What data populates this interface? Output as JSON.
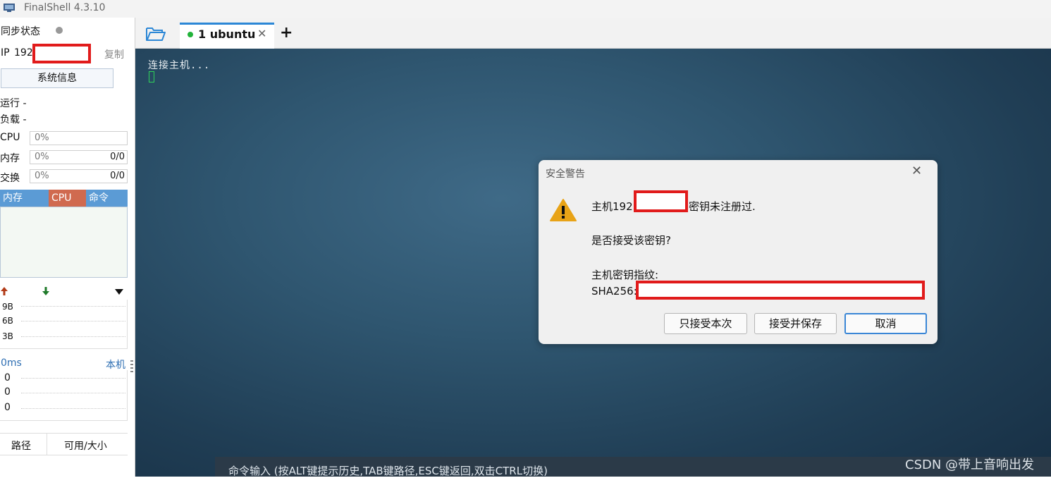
{
  "window": {
    "title": "FinalShell 4.3.10"
  },
  "sidebar": {
    "sync_label": "同步状态",
    "ip_label": "IP",
    "ip_value": "192",
    "copy_label": "复制",
    "sysinfo_button": "系统信息",
    "running_label": "运行 -",
    "load_label": "负载 -",
    "cpu": {
      "label": "CPU",
      "value": "0%"
    },
    "memory": {
      "label": "内存",
      "value": "0%",
      "total": "0/0"
    },
    "swap": {
      "label": "交换",
      "value": "0%",
      "total": "0/0"
    },
    "process_tabs": [
      "内存",
      "CPU",
      "命令"
    ],
    "net": {
      "ticks": [
        "9B",
        "6B",
        "3B"
      ]
    },
    "ping": {
      "value": "0ms",
      "target": "本机",
      "rows": [
        "0",
        "0",
        "0"
      ]
    },
    "disk_headers": [
      "路径",
      "可用/大小"
    ]
  },
  "tabs": [
    {
      "label": "1 ubuntu",
      "status_color": "#22b33a"
    }
  ],
  "terminal": {
    "text": "连接主机...",
    "command_hint": "命令输入 (按ALT键提示历史,TAB键路径,ESC键返回,双击CTRL切换)",
    "watermark": "CSDN @带上音响出发"
  },
  "dialog": {
    "title": "安全警告",
    "line1_prefix": "主机192",
    "line1_suffix": "密钥未注册过.",
    "question": "是否接受该密钥?",
    "fingerprint_label": "主机密钥指纹:",
    "fingerprint_prefix": "SHA256:",
    "buttons": {
      "once": "只接受本次",
      "save": "接受并保存",
      "cancel": "取消"
    }
  },
  "colors": {
    "accent": "#2c87d6",
    "redaction": "#e11b1b",
    "warning": "#e8a317",
    "tab_memory": "#5b9bd5",
    "tab_cpu": "#d06a4f"
  }
}
